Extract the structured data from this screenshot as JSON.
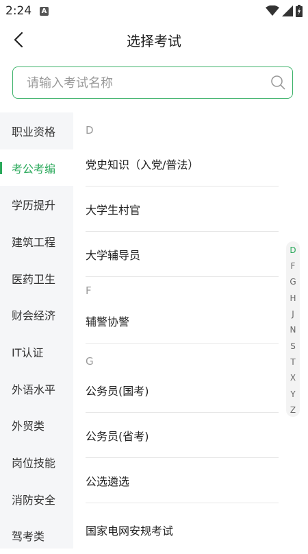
{
  "status_bar": {
    "time": "2:24",
    "notification_glyph": "A",
    "icons": [
      "wifi-icon",
      "signal-icon",
      "battery-icon"
    ]
  },
  "header": {
    "title": "选择考试"
  },
  "search": {
    "placeholder": "请输入考试名称"
  },
  "colors": {
    "accent": "#29a85a",
    "search_border": "#3fb36b"
  },
  "sidebar": {
    "items": [
      {
        "label": "职业资格"
      },
      {
        "label": "考公考编",
        "active": true
      },
      {
        "label": "学历提升"
      },
      {
        "label": "建筑工程"
      },
      {
        "label": "医药卫生"
      },
      {
        "label": "财会经济"
      },
      {
        "label": "IT认证"
      },
      {
        "label": "外语水平"
      },
      {
        "label": "外贸类"
      },
      {
        "label": "岗位技能"
      },
      {
        "label": "消防安全"
      },
      {
        "label": "驾考类"
      }
    ]
  },
  "list": {
    "sections": [
      {
        "letter": "D",
        "items": [
          "党史知识（入党/普法）",
          "大学生村官",
          "大学辅导员"
        ]
      },
      {
        "letter": "F",
        "items": [
          "辅警协警"
        ]
      },
      {
        "letter": "G",
        "items": [
          "公务员(国考)",
          "公务员(省考)",
          "公选遴选",
          "国家电网安规考试"
        ]
      }
    ]
  },
  "index_bar": {
    "letters": [
      "D",
      "F",
      "G",
      "H",
      "J",
      "N",
      "S",
      "T",
      "X",
      "Y",
      "Z"
    ],
    "active": "D"
  }
}
